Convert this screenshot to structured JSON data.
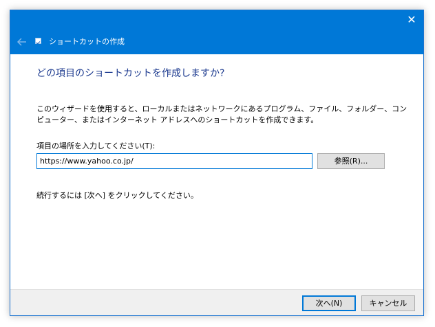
{
  "window": {
    "close_glyph": "✕"
  },
  "wizard": {
    "back_icon": "arrow-left-icon",
    "title": "ショートカットの作成"
  },
  "content": {
    "heading": "どの項目のショートカットを作成しますか?",
    "description": "このウィザードを使用すると、ローカルまたはネットワークにあるプログラム、ファイル、フォルダー、コンピューター、またはインターネット アドレスへのショートカットを作成できます。",
    "location_label": "項目の場所を入力してください(T):",
    "location_value": "https://www.yahoo.co.jp/",
    "browse_label": "参照(R)...",
    "hint": "続行するには [次へ] をクリックしてください。"
  },
  "footer": {
    "next_label": "次へ(N)",
    "cancel_label": "キャンセル"
  },
  "colors": {
    "accent": "#0078d7",
    "heading": "#1c3a8f"
  }
}
